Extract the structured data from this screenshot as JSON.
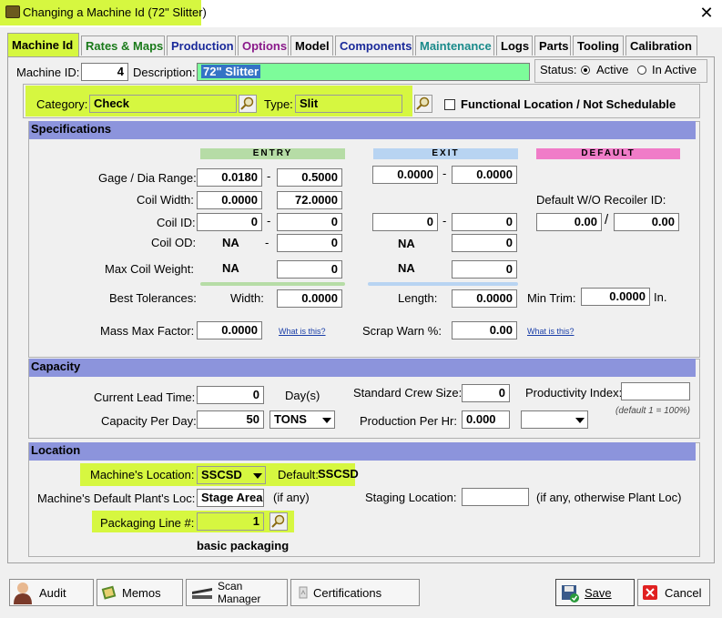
{
  "window": {
    "title": "Changing a Machine Id  (72\" Slitter)"
  },
  "tabs": [
    {
      "label": "Machine Id",
      "color": "#000000"
    },
    {
      "label": "Rates & Maps",
      "color": "#1a7a1a"
    },
    {
      "label": "Production",
      "color": "#1a2a9a"
    },
    {
      "label": "Options",
      "color": "#8a1a8a"
    },
    {
      "label": "Model",
      "color": "#000000"
    },
    {
      "label": "Components",
      "color": "#1a2a9a"
    },
    {
      "label": "Maintenance",
      "color": "#1a8a8a"
    },
    {
      "label": "Logs",
      "color": "#000000"
    },
    {
      "label": "Parts",
      "color": "#000000"
    },
    {
      "label": "Tooling",
      "color": "#000000"
    },
    {
      "label": "Calibration",
      "color": "#000000"
    }
  ],
  "header": {
    "machine_id_label": "Machine ID:",
    "machine_id": "4",
    "description_label": "Description:",
    "description": "72\" Slitter",
    "status_label": "Status:",
    "status_active": "Active",
    "status_inactive": "In Active",
    "category_label": "Category:",
    "category": "Check",
    "type_label": "Type:",
    "type": "Slit",
    "functional_label": "Functional Location / Not Schedulable"
  },
  "specs": {
    "title": "Specifications",
    "entry_header": "ENTRY",
    "exit_header": "EXIT",
    "default_header": "DEFAULT",
    "gage_label": "Gage / Dia Range:",
    "gage_entry_min": "0.0180",
    "gage_entry_max": "0.5000",
    "gage_exit_min": "0.0000",
    "gage_exit_max": "0.0000",
    "coil_width_label": "Coil Width:",
    "coil_width_min": "0.0000",
    "coil_width_max": "72.0000",
    "default_wo_label": "Default W/O Recoiler ID:",
    "coil_id_label": "Coil ID:",
    "coil_id_entry_min": "0",
    "coil_id_entry_max": "0",
    "coil_id_exit_min": "0",
    "coil_id_exit_max": "0",
    "default_min": "0.00",
    "default_max": "0.00",
    "coil_od_label": "Coil OD:",
    "na": "NA",
    "coil_od_entry_max": "0",
    "coil_od_exit_max": "0",
    "max_weight_label": "Max Coil Weight:",
    "max_weight_entry": "0",
    "max_weight_exit": "0",
    "best_tol_label": "Best Tolerances:",
    "width_label": "Width:",
    "width_value": "0.0000",
    "length_label": "Length:",
    "length_value": "0.0000",
    "min_trim_label": "Min Trim:",
    "min_trim_value": "0.0000",
    "min_trim_unit": "In.",
    "mass_max_label": "Mass Max Factor:",
    "mass_max_value": "0.0000",
    "what_is_this": "What is this?",
    "scrap_warn_label": "Scrap Warn %:",
    "scrap_warn_value": "0.00"
  },
  "capacity": {
    "title": "Capacity",
    "lead_time_label": "Current Lead Time:",
    "lead_time_value": "0",
    "lead_time_unit": "Day(s)",
    "crew_label": "Standard Crew Size:",
    "crew_value": "0",
    "productivity_label": "Productivity Index:",
    "productivity_value": "",
    "productivity_note": "(default 1 = 100%)",
    "per_day_label": "Capacity Per Day:",
    "per_day_value": "50",
    "per_day_unit": "TONS",
    "per_hr_label": "Production Per Hr:",
    "per_hr_value": "0.000",
    "per_hr_unit": ""
  },
  "location": {
    "title": "Location",
    "machine_loc_label": "Machine's Location:",
    "machine_loc_value": "SSCSD",
    "default_label": "Default:",
    "default_value": "SSCSD",
    "plant_loc_label": "Machine's Default Plant's Loc:",
    "plant_loc_value": "Stage Area",
    "plant_loc_note": "(if any)",
    "staging_label": "Staging Location:",
    "staging_value": "",
    "staging_note": "(if any, otherwise Plant Loc)",
    "packaging_label": "Packaging Line #:",
    "packaging_value": "1",
    "packaging_desc": "basic packaging"
  },
  "buttons": {
    "audit": "Audit",
    "memos": "Memos",
    "scan_line1": "Scan",
    "scan_line2": "Manager",
    "certifications": "Certifications",
    "save": "Save",
    "cancel": "Cancel"
  },
  "colors": {
    "highlight": "#d6f740",
    "section_bar": "#8c94dc",
    "entry_bar": "#b6dca6",
    "exit_bar": "#b8d4f2",
    "default_bar": "#f07cc8",
    "description_fill": "#7dfc9a",
    "cancel_red": "#e02020"
  }
}
